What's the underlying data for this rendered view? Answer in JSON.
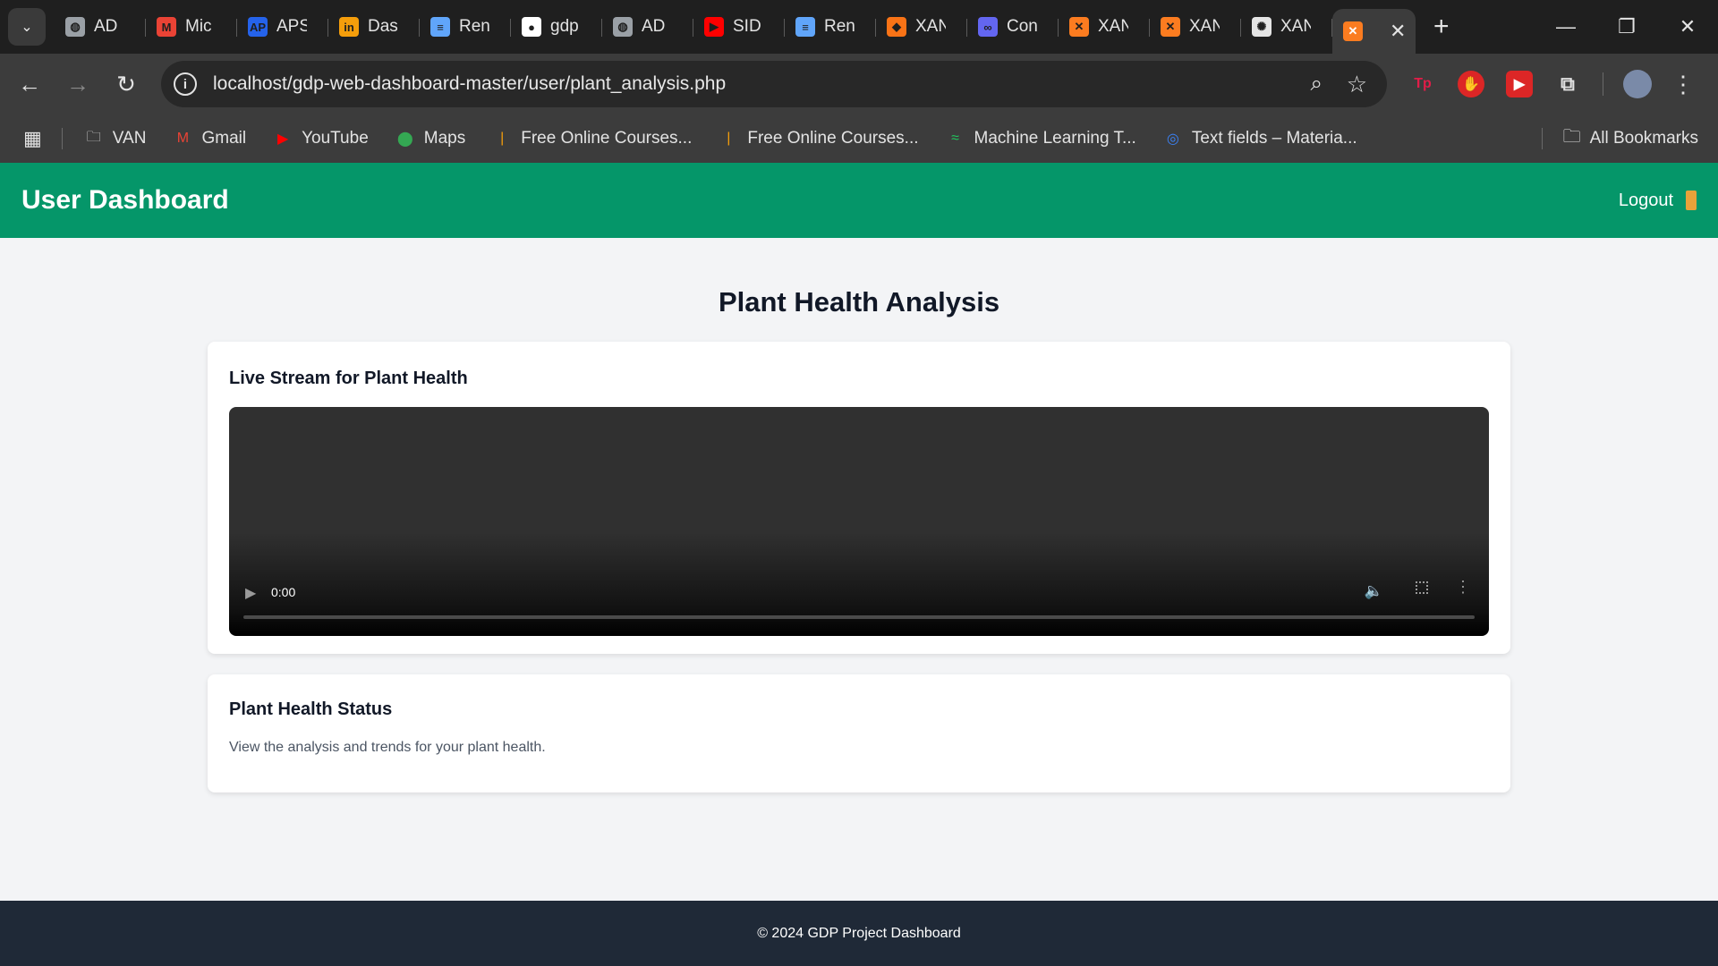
{
  "browser": {
    "tabs": [
      {
        "title": "AD",
        "favicon": "globe-icon",
        "color": "#9aa0a6"
      },
      {
        "title": "Mic",
        "favicon": "gmail-icon",
        "color": "#ea4335"
      },
      {
        "title": "APS",
        "favicon": "aps-icon",
        "color": "#2563eb"
      },
      {
        "title": "Das",
        "favicon": "in-icon",
        "color": "#f59e0b"
      },
      {
        "title": "Ren",
        "favicon": "ren-icon",
        "color": "#60a5fa"
      },
      {
        "title": "gdp",
        "favicon": "github-icon",
        "color": "#ffffff"
      },
      {
        "title": "AD",
        "favicon": "globe-icon",
        "color": "#9aa0a6"
      },
      {
        "title": "SID",
        "favicon": "youtube-icon",
        "color": "#ff0000"
      },
      {
        "title": "Ren",
        "favicon": "ren-icon",
        "color": "#60a5fa"
      },
      {
        "title": "XAN",
        "favicon": "diamond-icon",
        "color": "#f97316"
      },
      {
        "title": "Con",
        "favicon": "con-icon",
        "color": "#6366f1"
      },
      {
        "title": "XAN",
        "favicon": "xampp-icon",
        "color": "#fb7c20"
      },
      {
        "title": "XAN",
        "favicon": "xampp-icon",
        "color": "#fb7c20"
      },
      {
        "title": "XAN",
        "favicon": "openai-icon",
        "color": "#e5e5e5"
      }
    ],
    "active_tab_favicon_color": "#fb7c20",
    "url": "localhost/gdp-web-dashboard-master/user/plant_analysis.php",
    "bookmarks": [
      {
        "label": "VAN",
        "icon": "folder-icon"
      },
      {
        "label": "Gmail",
        "icon": "gmail-icon"
      },
      {
        "label": "YouTube",
        "icon": "youtube-icon"
      },
      {
        "label": "Maps",
        "icon": "maps-icon"
      },
      {
        "label": "Free Online Courses...",
        "icon": "course-icon"
      },
      {
        "label": "Free Online Courses...",
        "icon": "course-icon"
      },
      {
        "label": "Machine Learning T...",
        "icon": "ml-icon"
      },
      {
        "label": "Text fields – Materia...",
        "icon": "material-icon"
      }
    ],
    "all_bookmarks": "All Bookmarks"
  },
  "header": {
    "title": "User Dashboard",
    "logout_label": "Logout",
    "brand_color": "#059669"
  },
  "main": {
    "heading": "Plant Health Analysis",
    "stream_card": {
      "title": "Live Stream for Plant Health",
      "video_time": "0:00"
    },
    "status_card": {
      "title": "Plant Health Status",
      "text": "View the analysis and trends for your plant health."
    }
  },
  "footer": {
    "text": "© 2024 GDP Project Dashboard"
  }
}
